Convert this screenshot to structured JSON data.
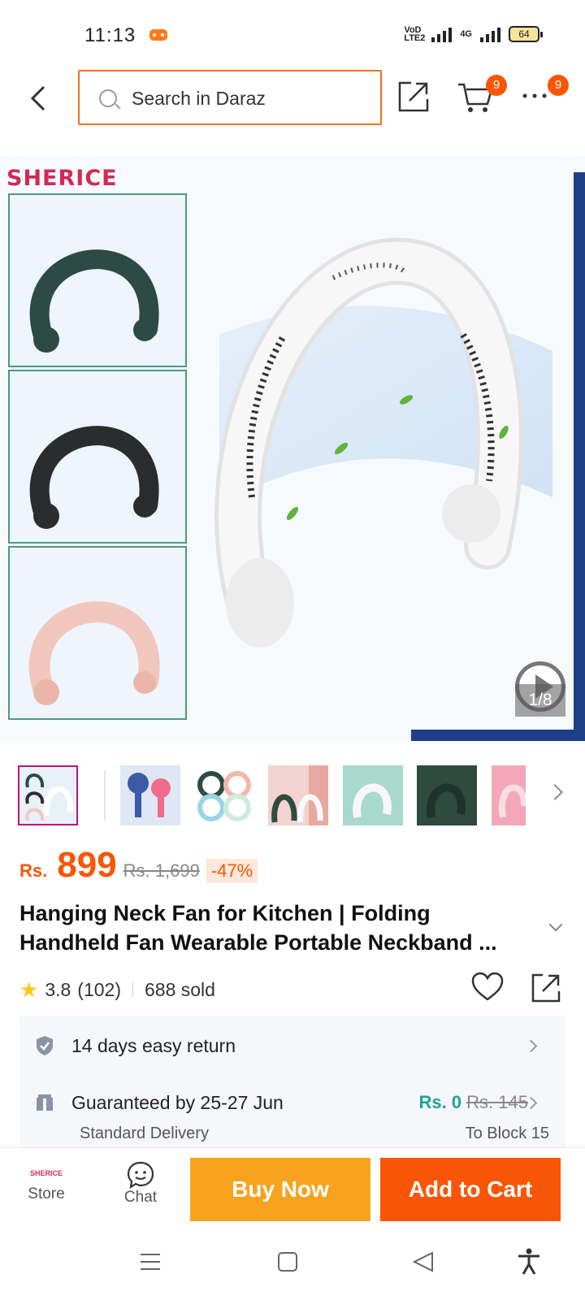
{
  "status_bar": {
    "time": "11:13",
    "volte": "VoD LTE2",
    "network": "4G",
    "battery": "64"
  },
  "header": {
    "search_placeholder": "Search in Daraz",
    "cart_badge": "9",
    "more_badge": "9"
  },
  "gallery": {
    "brand": "SHERICE",
    "counter": "1/8",
    "variant_colors": [
      "#2d4a45",
      "#2a2c2e",
      "#f1c7bd"
    ],
    "main_color": "#f4f4f4",
    "thumbnails": [
      {
        "label": "neck fan variants",
        "color": "#e8f0f8"
      },
      {
        "label": "handheld fans",
        "color": "#3c5aa6"
      },
      {
        "label": "neck fan colors",
        "color": "#9ad4e6"
      },
      {
        "label": "neck fan pair",
        "color": "#f2d3cf"
      },
      {
        "label": "white neck fan",
        "color": "#a9d8cc"
      },
      {
        "label": "green neck fan",
        "color": "#2f4a3e"
      },
      {
        "label": "pink neck fan",
        "color": "#f4a7b8"
      }
    ]
  },
  "price": {
    "currency": "Rs.",
    "amount": "899",
    "original": "Rs. 1,699",
    "discount": "-47%"
  },
  "product": {
    "title_line1": "Hanging Neck Fan for Kitchen | Folding",
    "title_line2": "Handheld Fan Wearable Portable Neckband ...",
    "rating": "3.8",
    "reviews": "(102)",
    "sold": "688 sold"
  },
  "services": {
    "return_text": "14 days easy return",
    "delivery_text": "Guaranteed by 25-27 Jun",
    "delivery_type": "Standard Delivery",
    "fee_new": "Rs. 0",
    "fee_old": "Rs. 145",
    "destination": "To Block 15"
  },
  "bottom_bar": {
    "store_logo": "SHERICE",
    "store_label": "Store",
    "chat_label": "Chat",
    "buy_now": "Buy Now",
    "add_to_cart": "Add to Cart"
  },
  "colors": {
    "accent": "#f85606",
    "buy_now": "#f7a31e",
    "search_border": "#f36e21",
    "free_fee": "#1fa39b"
  }
}
